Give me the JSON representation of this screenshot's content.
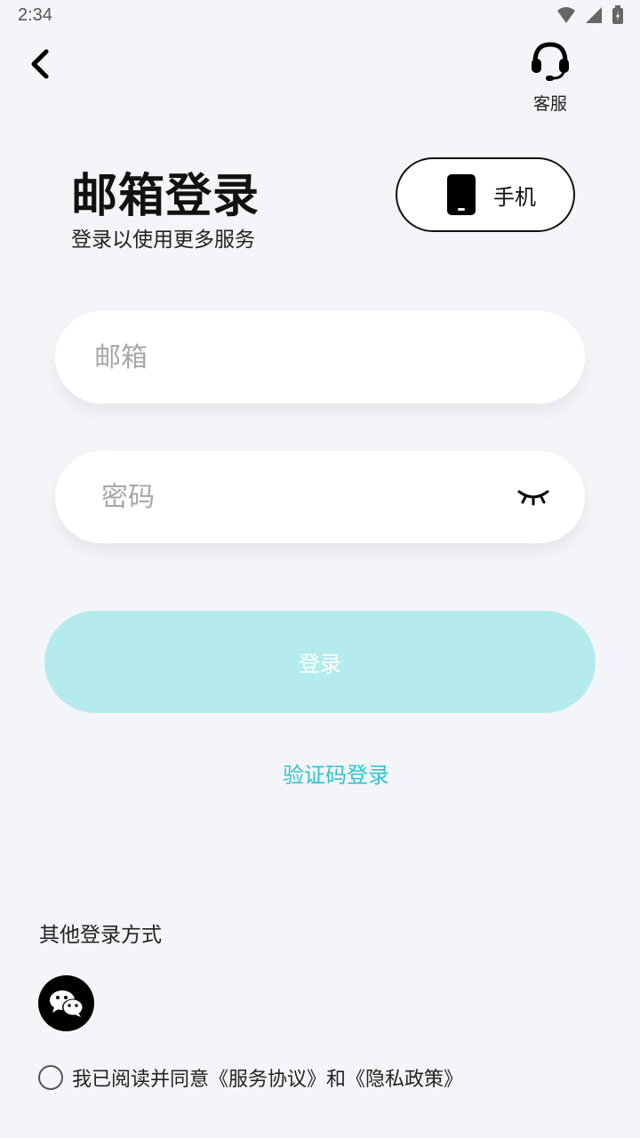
{
  "status_bar": {
    "time": "2:34"
  },
  "header": {
    "customer_service_label": "客服"
  },
  "title": {
    "heading": "邮箱登录",
    "subtitle": "登录以使用更多服务"
  },
  "switch_mode": {
    "label": "手机"
  },
  "form": {
    "email_placeholder": "邮箱",
    "password_placeholder": "密码",
    "login_label": "登录",
    "code_login_label": "验证码登录"
  },
  "other": {
    "title": "其他登录方式"
  },
  "agreement": {
    "text": "我已阅读并同意《服务协议》和《隐私政策》"
  },
  "colors": {
    "accent": "#2cc6cf",
    "login_button_disabled": "#b5ebed",
    "background": "#f4f5f9"
  },
  "icons": [
    "back-icon",
    "headset-icon",
    "phone-icon",
    "closed-eye-icon",
    "wechat-icon",
    "wifi-icon",
    "signal-icon",
    "battery-icon"
  ]
}
